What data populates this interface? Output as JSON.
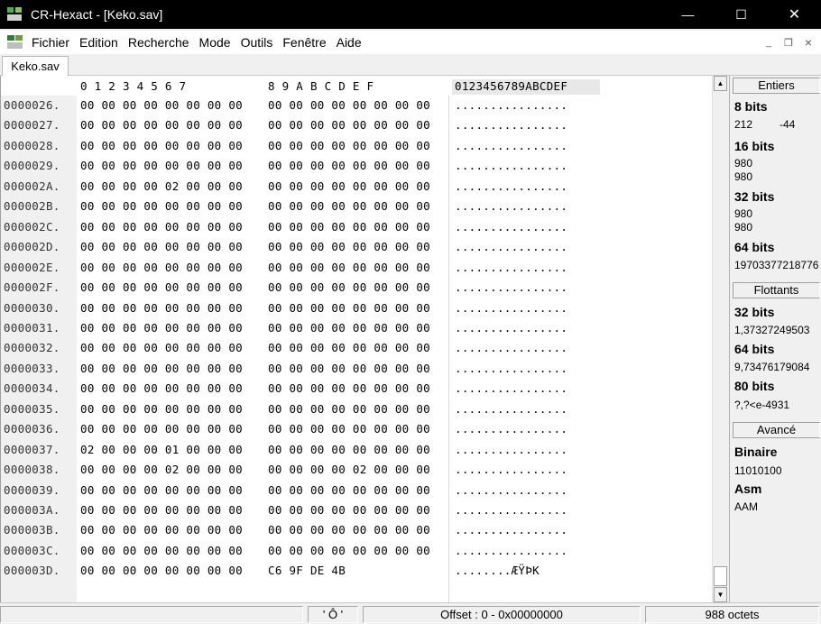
{
  "window": {
    "title": "CR-Hexact - [Keko.sav]",
    "minimize_glyph": "—",
    "maximize_glyph": "☐",
    "close_glyph": "✕"
  },
  "menu": {
    "items": [
      "Fichier",
      "Edition",
      "Recherche",
      "Mode",
      "Outils",
      "Fenêtre",
      "Aide"
    ],
    "mdi_minimize": "_",
    "mdi_restore": "❐",
    "mdi_close": "×"
  },
  "tab": {
    "label": "Keko.sav"
  },
  "hex": {
    "header_hex1": "0 1 2 3 4 5 6 7",
    "header_hex2": "8 9 A B C D E F",
    "header_ascii": "0123456789ABCDEF",
    "rows": [
      {
        "addr": "0000026.",
        "hex1": "00 00 00 00 00 00 00 00",
        "hex2": "00 00 00 00 00 00 00 00",
        "ascii": "................"
      },
      {
        "addr": "0000027.",
        "hex1": "00 00 00 00 00 00 00 00",
        "hex2": "00 00 00 00 00 00 00 00",
        "ascii": "................"
      },
      {
        "addr": "0000028.",
        "hex1": "00 00 00 00 00 00 00 00",
        "hex2": "00 00 00 00 00 00 00 00",
        "ascii": "................"
      },
      {
        "addr": "0000029.",
        "hex1": "00 00 00 00 00 00 00 00",
        "hex2": "00 00 00 00 00 00 00 00",
        "ascii": "................"
      },
      {
        "addr": "000002A.",
        "hex1": "00 00 00 00 02 00 00 00",
        "hex2": "00 00 00 00 00 00 00 00",
        "ascii": "................"
      },
      {
        "addr": "000002B.",
        "hex1": "00 00 00 00 00 00 00 00",
        "hex2": "00 00 00 00 00 00 00 00",
        "ascii": "................"
      },
      {
        "addr": "000002C.",
        "hex1": "00 00 00 00 00 00 00 00",
        "hex2": "00 00 00 00 00 00 00 00",
        "ascii": "................"
      },
      {
        "addr": "000002D.",
        "hex1": "00 00 00 00 00 00 00 00",
        "hex2": "00 00 00 00 00 00 00 00",
        "ascii": "................"
      },
      {
        "addr": "000002E.",
        "hex1": "00 00 00 00 00 00 00 00",
        "hex2": "00 00 00 00 00 00 00 00",
        "ascii": "................"
      },
      {
        "addr": "000002F.",
        "hex1": "00 00 00 00 00 00 00 00",
        "hex2": "00 00 00 00 00 00 00 00",
        "ascii": "................"
      },
      {
        "addr": "0000030.",
        "hex1": "00 00 00 00 00 00 00 00",
        "hex2": "00 00 00 00 00 00 00 00",
        "ascii": "................"
      },
      {
        "addr": "0000031.",
        "hex1": "00 00 00 00 00 00 00 00",
        "hex2": "00 00 00 00 00 00 00 00",
        "ascii": "................"
      },
      {
        "addr": "0000032.",
        "hex1": "00 00 00 00 00 00 00 00",
        "hex2": "00 00 00 00 00 00 00 00",
        "ascii": "................"
      },
      {
        "addr": "0000033.",
        "hex1": "00 00 00 00 00 00 00 00",
        "hex2": "00 00 00 00 00 00 00 00",
        "ascii": "................"
      },
      {
        "addr": "0000034.",
        "hex1": "00 00 00 00 00 00 00 00",
        "hex2": "00 00 00 00 00 00 00 00",
        "ascii": "................"
      },
      {
        "addr": "0000035.",
        "hex1": "00 00 00 00 00 00 00 00",
        "hex2": "00 00 00 00 00 00 00 00",
        "ascii": "................"
      },
      {
        "addr": "0000036.",
        "hex1": "00 00 00 00 00 00 00 00",
        "hex2": "00 00 00 00 00 00 00 00",
        "ascii": "................"
      },
      {
        "addr": "0000037.",
        "hex1": "02 00 00 00 01 00 00 00",
        "hex2": "00 00 00 00 00 00 00 00",
        "ascii": "................"
      },
      {
        "addr": "0000038.",
        "hex1": "00 00 00 00 02 00 00 00",
        "hex2": "00 00 00 00 02 00 00 00",
        "ascii": "................"
      },
      {
        "addr": "0000039.",
        "hex1": "00 00 00 00 00 00 00 00",
        "hex2": "00 00 00 00 00 00 00 00",
        "ascii": "................"
      },
      {
        "addr": "000003A.",
        "hex1": "00 00 00 00 00 00 00 00",
        "hex2": "00 00 00 00 00 00 00 00",
        "ascii": "................"
      },
      {
        "addr": "000003B.",
        "hex1": "00 00 00 00 00 00 00 00",
        "hex2": "00 00 00 00 00 00 00 00",
        "ascii": "................"
      },
      {
        "addr": "000003C.",
        "hex1": "00 00 00 00 00 00 00 00",
        "hex2": "00 00 00 00 00 00 00 00",
        "ascii": "................"
      },
      {
        "addr": "000003D.",
        "hex1": "00 00 00 00 00 00 00 00",
        "hex2": "C6 9F DE 4B",
        "ascii": "........ÆŸÞK"
      }
    ]
  },
  "panel": {
    "entiers_header": "Entiers",
    "b8_label": "8 bits",
    "b8_unsigned": "212",
    "b8_signed": "-44",
    "b16_label": "16 bits",
    "b16_v1": "980",
    "b16_v2": "980",
    "b32_label": "32 bits",
    "b32_v1": "980",
    "b32_v2": "980",
    "b64_label": "64 bits",
    "b64_v1": "19703377218776",
    "flottants_header": "Flottants",
    "f32_label": "32 bits",
    "f32_v": "1,37327249503",
    "f64_label": "64 bits",
    "f64_v": "9,73476179084",
    "f80_label": "80 bits",
    "f80_v": "?,?<e-4931",
    "avance_header": "Avancé",
    "binaire_label": "Binaire",
    "binaire_v": "11010100",
    "asm_label": "Asm",
    "asm_v": "AAM"
  },
  "status": {
    "char": "' Ô '",
    "offset": "Offset : 0  -  0x00000000",
    "size": "988 octets"
  },
  "colors": {
    "titlebar_bg": "#000000",
    "chrome_bg": "#f0f0f0",
    "hex_bg": "#ffffff"
  }
}
